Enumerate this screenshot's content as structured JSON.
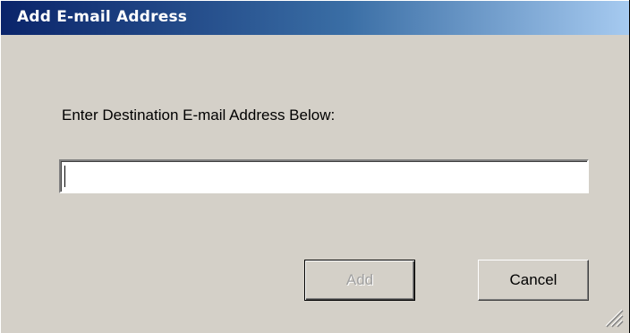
{
  "window": {
    "title": "Add E-mail Address"
  },
  "form": {
    "prompt_label": "Enter Destination E-mail Address Below:",
    "email_value": "",
    "email_placeholder": ""
  },
  "buttons": {
    "add_label": "Add",
    "add_enabled": false,
    "cancel_label": "Cancel"
  },
  "icons": {
    "size_grip": "resize-grip-icon"
  },
  "colors": {
    "title_start": "#0a246a",
    "title_end": "#a6caf0",
    "dialog_face": "#d4d0c8",
    "disabled_text": "#a0a0a0"
  }
}
